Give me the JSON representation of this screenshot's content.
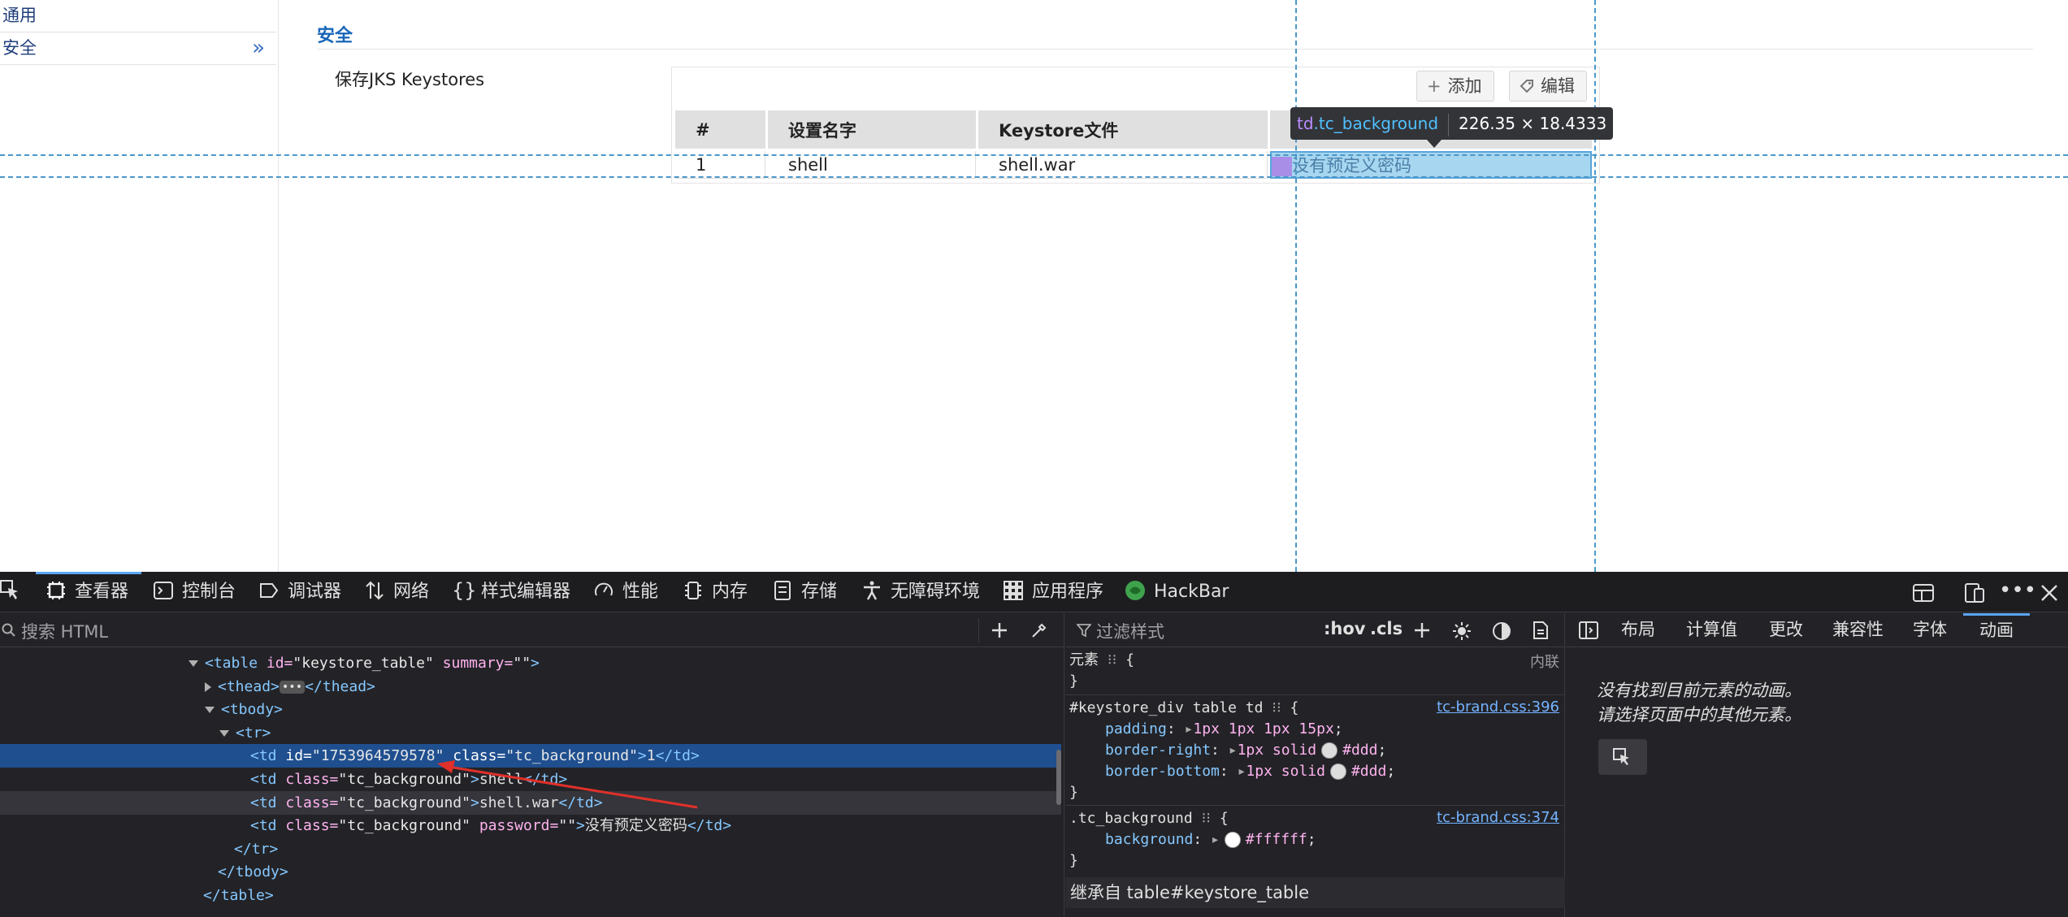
{
  "nav": {
    "items": [
      {
        "label": "通用"
      },
      {
        "label": "安全"
      }
    ]
  },
  "section": {
    "title": "安全",
    "keystores_label": "保存JKS Keystores"
  },
  "toolbar": {
    "add_label": "添加",
    "edit_label": "编辑"
  },
  "table": {
    "headers": [
      "#",
      "设置名字",
      "Keystore文件",
      ""
    ],
    "rows": [
      {
        "num": "1",
        "name": "shell",
        "file": "shell.war",
        "password": "没有预定义密码"
      }
    ]
  },
  "infobar": {
    "tag": "td",
    "class": ".tc_background",
    "size": "226.35 × 18.4333"
  },
  "devtools": {
    "tabs": [
      "查看器",
      "控制台",
      "调试器",
      "网络",
      "样式编辑器",
      "性能",
      "内存",
      "存储",
      "无障碍环境",
      "应用程序",
      "HackBar"
    ],
    "html_search_placeholder": "搜索 HTML",
    "tree": {
      "table_tag": "table",
      "table_id": "keystore_table",
      "table_summary": "",
      "thead": "thead",
      "tbody": "tbody",
      "tr": "tr",
      "td1_id": "1753964579578",
      "td_class": "tc_background",
      "td1_text": "1",
      "td2_text": "shell",
      "td3_text": "shell.war",
      "td4_text": "没有预定义密码"
    },
    "rules": {
      "filter_placeholder": "过滤样式",
      "hov": ":hov",
      "cls": ".cls",
      "element_selector": "元素",
      "element_origin": "内联",
      "r1_selector": "#keystore_div table td",
      "r1_source": "tc-brand.css:396",
      "r1_props": [
        {
          "name": "padding",
          "value": "1px 1px 1px 15px"
        },
        {
          "name": "border-right",
          "value": "1px solid",
          "color": "#ddd"
        },
        {
          "name": "border-bottom",
          "value": "1px solid",
          "color": "#ddd"
        }
      ],
      "r2_selector": ".tc_background",
      "r2_source": "tc-brand.css:374",
      "r2_props": [
        {
          "name": "background",
          "color": "#ffffff"
        }
      ],
      "inherited_label": "继承自 table#keystore_table"
    },
    "side": {
      "tabs": [
        "布局",
        "计算值",
        "更改",
        "兼容性",
        "字体",
        "动画"
      ],
      "message_line1": "没有找到目前元素的动画。",
      "message_line2": "请选择页面中的其他元素。"
    }
  },
  "colors": {
    "accent": "#1765b8",
    "selection": "#1f4f8f",
    "highlight_cell": "#a7d6f0",
    "padding_overlay": "#a98ee8",
    "annotation_arrow": "#e0302a"
  }
}
